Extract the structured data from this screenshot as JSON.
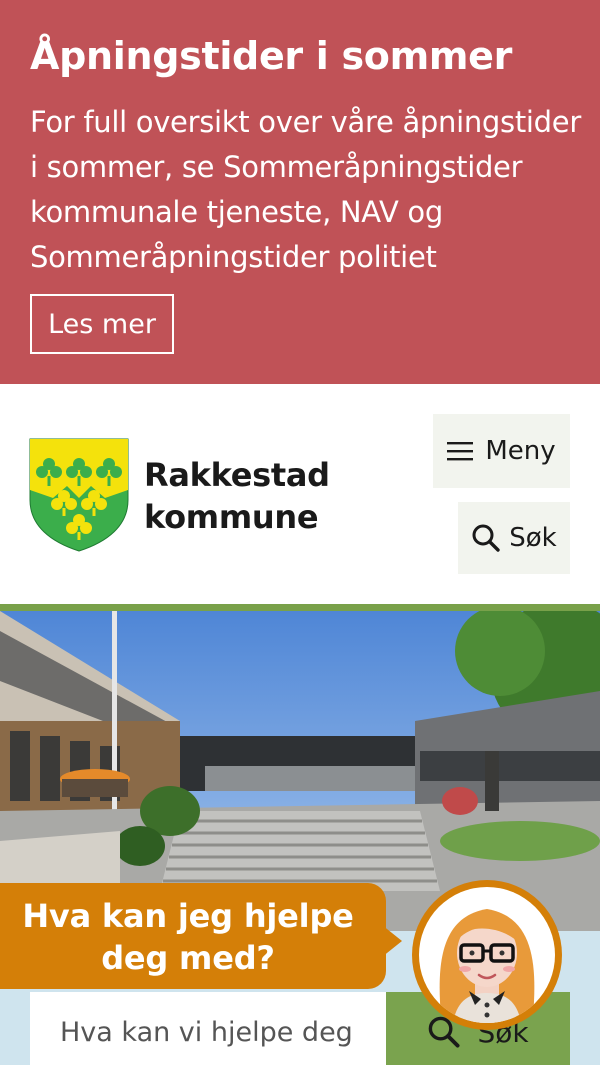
{
  "banner": {
    "title": "Åpningstider i sommer",
    "text": "For full oversikt over våre åpningstider i sommer, se Sommeråpningstider kommunale tjeneste, NAV og Sommeråpningstider politiet",
    "button_label": "Les mer",
    "background_color": "#c05257"
  },
  "header": {
    "logo_line1": "Rakkestad",
    "logo_line2": "kommune",
    "menu_label": "Meny",
    "search_label": "Søk",
    "accent_color": "#79a14a"
  },
  "assistant": {
    "question": "Hva kan jeg hjelpe deg med?",
    "bubble_color": "#d47f08",
    "avatar_icon": "assistant-avatar-icon"
  },
  "search": {
    "placeholder": "Hva kan vi hjelpe deg med?",
    "submit_label": "Søk",
    "button_color": "#7aa34e"
  },
  "icons": {
    "menu": "hamburger-icon",
    "search": "search-icon",
    "logo": "coat-of-arms-icon"
  }
}
